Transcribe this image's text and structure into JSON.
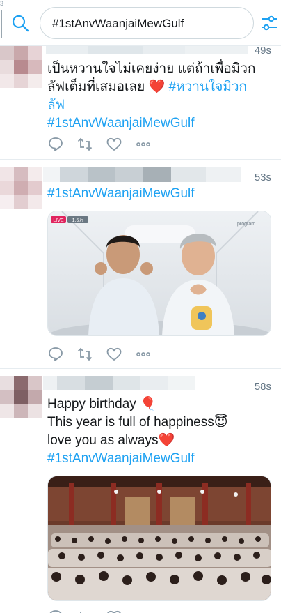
{
  "topbar": {
    "edge_mark": "3",
    "search_value": "#1stAnvWaanjaiMewGulf"
  },
  "icons": {
    "search": "search-icon",
    "filter": "filter-sliders-icon",
    "reply": "reply-icon",
    "retweet": "retweet-icon",
    "like": "heart-icon",
    "more": "more-dots-icon"
  },
  "colors": {
    "accent": "#1da1f2",
    "text": "#14171a",
    "muted": "#657786",
    "like_heart": "#e0245e"
  },
  "tweets": [
    {
      "time": "49s",
      "text_line1": "เป็นหวานใจไม่เคยง่าย แต่ถ้าเพื่อมิวก",
      "text_line2_prefix": "ลัฟเต็มที่เสมอเลย ",
      "heart_emoji": "❤️",
      "hashtag_thai": "#หวานใจมิวก",
      "hashtag_thai_cont": "ลัฟ",
      "hashtag": "#1stAnvWaanjaiMewGulf"
    },
    {
      "time": "53s",
      "hashtag": "#1stAnvWaanjaiMewGulf",
      "media": {
        "live_badge": "LIVE",
        "viewers": "1.5万",
        "watermark": "program"
      }
    },
    {
      "time": "58s",
      "line1": "Happy birthday ",
      "balloon": "🎈",
      "line2": "This year is full of happiness",
      "angel": "😇",
      "line3": "love you as always",
      "heart": "❤️",
      "hashtag": "#1stAnvWaanjaiMewGulf"
    }
  ]
}
